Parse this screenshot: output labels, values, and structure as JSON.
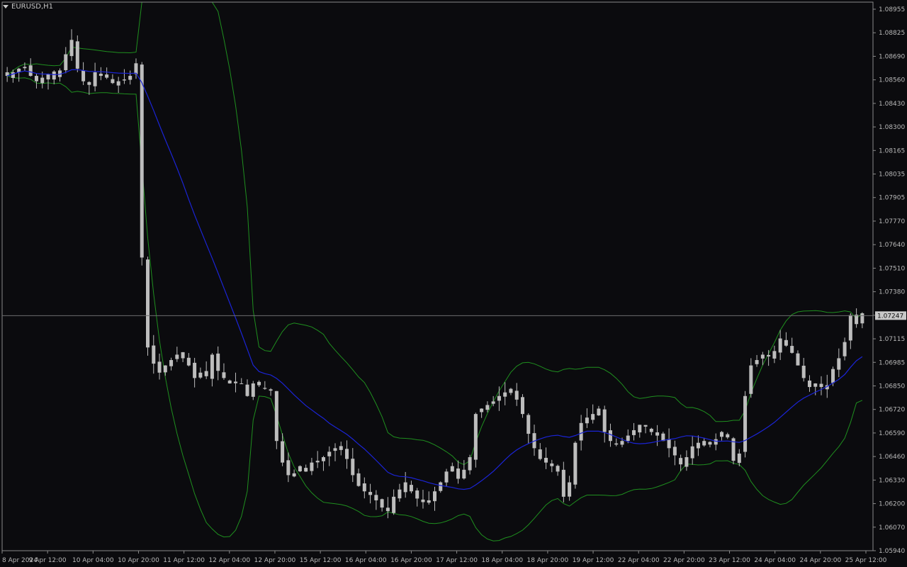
{
  "header": {
    "symbol": "EURUSD,H1"
  },
  "chart_data": {
    "type": "candlestick",
    "symbol": "EURUSD",
    "timeframe": "H1",
    "y_ticks": [
      "1.08955",
      "1.08825",
      "1.08690",
      "1.08560",
      "1.08430",
      "1.08300",
      "1.08165",
      "1.08035",
      "1.07905",
      "1.07770",
      "1.07640",
      "1.07510",
      "1.07380",
      "1.07247",
      "1.07115",
      "1.06985",
      "1.06850",
      "1.06720",
      "1.06590",
      "1.06460",
      "1.06330",
      "1.06200",
      "1.06070",
      "1.05940"
    ],
    "ylim": [
      1.0594,
      1.0899
    ],
    "current_price": "1.07247",
    "x_ticks": [
      "8 Apr 2024",
      "9 Apr 12:00",
      "10 Apr 04:00",
      "10 Apr 20:00",
      "11 Apr 12:00",
      "12 Apr 04:00",
      "12 Apr 20:00",
      "15 Apr 12:00",
      "16 Apr 04:00",
      "16 Apr 20:00",
      "17 Apr 12:00",
      "18 Apr 04:00",
      "18 Apr 20:00",
      "19 Apr 12:00",
      "22 Apr 04:00",
      "22 Apr 20:00",
      "23 Apr 12:00",
      "24 Apr 04:00",
      "24 Apr 20:00",
      "25 Apr 12:00"
    ],
    "closes": [
      1.0858,
      1.086,
      1.0862,
      1.0863,
      1.0858,
      1.0855,
      1.0857,
      1.0859,
      1.0856,
      1.0861,
      1.087,
      1.0878,
      1.0862,
      1.0855,
      1.0853,
      1.086,
      1.0858,
      1.0857,
      1.0854,
      1.0855,
      1.0856,
      1.0858,
      1.0865,
      1.0757,
      1.0707,
      1.0698,
      1.0693,
      1.0697,
      1.07,
      1.0703,
      1.0701,
      1.0697,
      1.069,
      1.0693,
      1.0691,
      1.0703,
      1.0694,
      1.069,
      1.0687,
      1.0688,
      1.0687,
      1.068,
      1.0687,
      1.0686,
      1.0684,
      1.0683,
      1.0655,
      1.0643,
      1.0636,
      1.0637,
      1.0641,
      1.0638,
      1.0643,
      1.0644,
      1.0646,
      1.0649,
      1.0651,
      1.065,
      1.0645,
      1.0636,
      1.063,
      1.0627,
      1.0625,
      1.0622,
      1.0618,
      1.0616,
      1.0624,
      1.0628,
      1.0632,
      1.0627,
      1.0623,
      1.0621,
      1.0622,
      1.0627,
      1.0632,
      1.0638,
      1.0641,
      1.0634,
      1.0639,
      1.0646,
      1.067,
      1.0673,
      1.0675,
      1.0677,
      1.068,
      1.0682,
      1.0684,
      1.0678,
      1.067,
      1.0659,
      1.0651,
      1.0645,
      1.0643,
      1.0641,
      1.0638,
      1.0624,
      1.0632,
      1.0654,
      1.0665,
      1.0668,
      1.067,
      1.0673,
      1.066,
      1.0655,
      1.0653,
      1.0655,
      1.0658,
      1.0661,
      1.0664,
      1.0663,
      1.066,
      1.0658,
      1.0655,
      1.0651,
      1.0647,
      1.0642,
      1.0646,
      1.0652,
      1.0654,
      1.0655,
      1.0653,
      1.0656,
      1.066,
      1.0657,
      1.0644,
      1.0648,
      1.068,
      1.0697,
      1.07,
      1.0703,
      1.0702,
      1.0705,
      1.0712,
      1.0708,
      1.0704,
      1.0697,
      1.069,
      1.0685,
      1.0687,
      1.0685,
      1.0686,
      1.0695,
      1.0701,
      1.071,
      1.0725,
      1.072,
      1.0726
    ]
  },
  "colors": {
    "background": "#0b0b0e",
    "candle": "#bdbdbd",
    "ma": "#1b24d6",
    "bands": "#1f8f1f",
    "grid_line": "#6e6e6e"
  }
}
